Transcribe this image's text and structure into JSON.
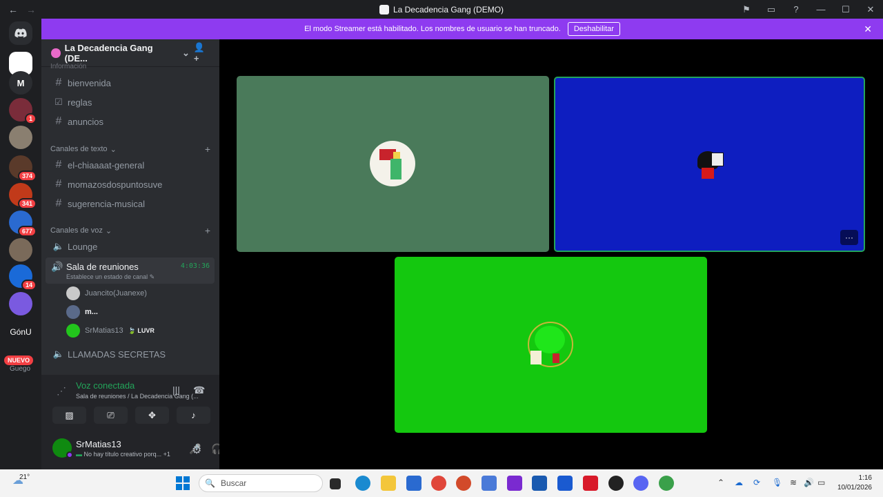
{
  "window": {
    "title": "La Decadencia Gang (DEMO)",
    "back_icon": "←",
    "forward_icon": "→"
  },
  "banner": {
    "text": "El modo Streamer está habilitado. Los nombres de usuario se han truncado.",
    "button_label": "Deshabilitar",
    "close_icon": "✕",
    "color": "#8e3bf0"
  },
  "server_rail": {
    "home_icon": "discord-icon",
    "servers": [
      {
        "label": "",
        "badge": "",
        "color": "#ffffff"
      },
      {
        "label": "M",
        "badge": "",
        "color": "#2b2d31"
      },
      {
        "label": "",
        "badge": "1",
        "color": "#7a2c3a"
      },
      {
        "label": "",
        "badge": "",
        "color": "#8a7f70"
      },
      {
        "label": "",
        "badge": "374",
        "color": "#5a3a2a"
      },
      {
        "label": "",
        "badge": "341",
        "color": "#c13a1a"
      },
      {
        "label": "",
        "badge": "677",
        "color": "#2a6ad0"
      },
      {
        "label": "",
        "badge": "",
        "color": "#7a6a5a"
      },
      {
        "label": "",
        "badge": "14",
        "color": "#1a6ad8"
      },
      {
        "label": "",
        "badge": "",
        "color": "#7a5ae0"
      },
      {
        "label": "GónU",
        "badge": "",
        "color": "#1e1f22"
      }
    ],
    "new_badge": "NUEVO",
    "new_sub": "Guego"
  },
  "sidebar": {
    "server_name": "La Decadencia Gang (DE...",
    "top_category_fragment": "Información",
    "info_channels": [
      {
        "name": "bienvenida",
        "icon": "#"
      },
      {
        "name": "reglas",
        "icon": "☑"
      },
      {
        "name": "anuncios",
        "icon": "#"
      }
    ],
    "text_category": "Canales de texto",
    "text_channels": [
      "el-chiaaaat-general",
      "momazosdospuntosuve",
      "sugerencia-musical"
    ],
    "voice_category": "Canales de voz",
    "voice_channels": [
      {
        "name": "Lounge"
      },
      {
        "name": "Sala de reuniones",
        "timer": "4:03:36",
        "status": "Establece un estado de canal"
      },
      {
        "name": "LLAMADAS SECRETAS"
      }
    ],
    "voice_users": [
      {
        "name": "Juancito(Juanexe)",
        "tag": "",
        "color": "#c9c9c9"
      },
      {
        "name": "m...",
        "tag": "",
        "color": "#5a6a8a"
      },
      {
        "name": "SrMatias13",
        "tag": "LUVR",
        "color": "#22c51c"
      }
    ]
  },
  "voice_panel": {
    "title": "Voz conectada",
    "subtitle": "Sala de reuniones / La Decadencia Gang (...",
    "buttons": [
      "camera-off-icon",
      "screen-share-icon",
      "activities-icon",
      "soundboard-icon"
    ]
  },
  "user_panel": {
    "username": "SrMatias13",
    "status": "No hay título creativo porq...",
    "extra": "+1"
  },
  "stage": {
    "tiles": [
      {
        "name": "tile-user-1",
        "bg": "#4a7a5a",
        "border": "none"
      },
      {
        "name": "tile-user-2",
        "bg": "#0e1ec0",
        "border": "#23a55a"
      },
      {
        "name": "tile-user-3",
        "bg": "#14c80f",
        "border": "none"
      }
    ],
    "more_label": "···"
  },
  "taskbar": {
    "temperature": "21°",
    "search_placeholder": "Buscar",
    "time": "1:16",
    "date": "10/01/2026"
  }
}
